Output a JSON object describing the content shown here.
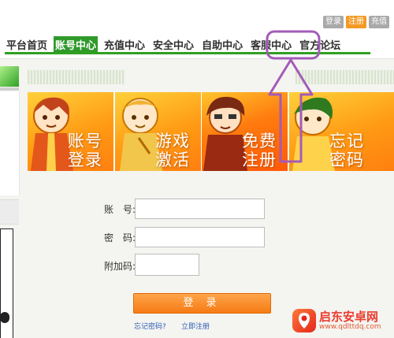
{
  "header": {
    "top_links": [
      "登录",
      "注册",
      "充值"
    ],
    "nav": [
      {
        "label": "平台首页",
        "active": false
      },
      {
        "label": "账号中心",
        "active": true
      },
      {
        "label": "充值中心",
        "active": false
      },
      {
        "label": "安全中心",
        "active": false
      },
      {
        "label": "自助中心",
        "active": false
      },
      {
        "label": "客服中心",
        "active": false,
        "highlighted": true
      },
      {
        "label": "官方论坛",
        "active": false
      }
    ]
  },
  "tiles": [
    {
      "line1": "账号",
      "line2": "登录"
    },
    {
      "line1": "游戏",
      "line2": "激活"
    },
    {
      "line1": "免费",
      "line2": "注册"
    },
    {
      "line1": "忘记",
      "line2": "密码"
    }
  ],
  "form": {
    "account_label": "账　号:",
    "password_label": "密　码:",
    "extra_label": "附加码:",
    "account_value": "",
    "password_value": "",
    "extra_value": "",
    "login_label": "登 录",
    "forgot_link": "忘记密码?",
    "register_link": "立即注册"
  },
  "annotation": {
    "color": "#a35bb8"
  },
  "watermark": {
    "title": "启东安卓网",
    "url": "www.qdlttdq.com"
  },
  "colors": {
    "nav_active": "#2f9a2a",
    "nav_underline": "#2fa021",
    "tile_orange": "#ff9b14",
    "button": "#f57b14"
  }
}
